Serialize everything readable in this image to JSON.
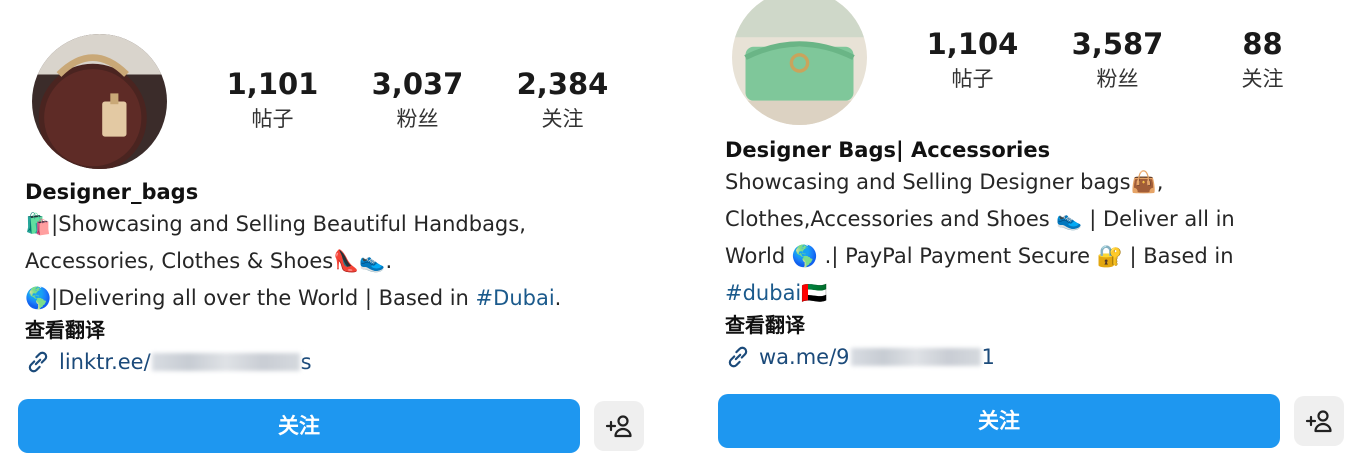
{
  "profiles": [
    {
      "stats": [
        {
          "value": "1,101",
          "label": "帖子"
        },
        {
          "value": "3,037",
          "label": "粉丝"
        },
        {
          "value": "2,384",
          "label": "关注"
        }
      ],
      "name": "Designer_bags",
      "bio_lines": [
        {
          "prefix": "🛍️",
          "text": "|Showcasing and Selling Beautiful Handbags,"
        },
        {
          "text": "Accessories, Clothes & Shoes",
          "suffix": "👠👟."
        },
        {
          "prefix": "🌎",
          "text": "|Delivering all over the World | Based in ",
          "hashtag": "#Dubai",
          "suffix": "."
        }
      ],
      "translate_label": "查看翻译",
      "link_prefix": "linktr.ee/",
      "link_suffix": "s",
      "follow_label": "关注"
    },
    {
      "stats": [
        {
          "value": "1,104",
          "label": "帖子"
        },
        {
          "value": "3,587",
          "label": "粉丝"
        },
        {
          "value": "88",
          "label": "关注"
        }
      ],
      "name": "Designer Bags| Accessories",
      "bio_lines": [
        {
          "text": "Showcasing and Selling Designer bags",
          "suffix": "👜,"
        },
        {
          "text": "Clothes,Accessories and Shoes 👟 | Deliver all in"
        },
        {
          "text": "World 🌎 .| PayPal Payment Secure 🔐 | Based in"
        },
        {
          "hashtag": "#dubai",
          "suffix": "🇦🇪"
        }
      ],
      "translate_label": "查看翻译",
      "link_prefix": "wa.me/9",
      "link_suffix": "1",
      "follow_label": "关注"
    }
  ],
  "icons": {
    "link": "link-icon",
    "add_user": "add-person-icon"
  },
  "colors": {
    "follow_button": "#1e97f0",
    "hashtag": "#1b5a8c",
    "link": "#1b4a7a"
  }
}
